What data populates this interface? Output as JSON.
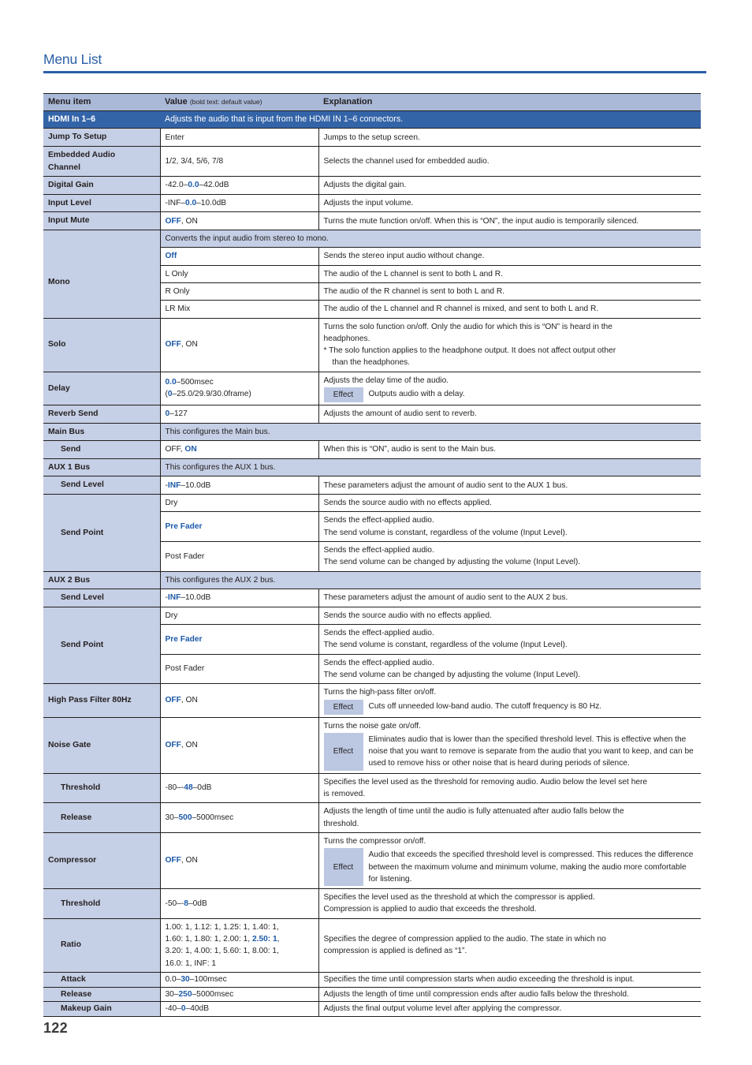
{
  "heading": {
    "title": "Menu List"
  },
  "page_number": "122",
  "colors": {
    "accent_blue": "#2a5fa6",
    "banner_blue": "#3464a8",
    "header_lavender": "#aab9d8",
    "group_lavender": "#c5cfe5",
    "default_value_blue": "#1c5aa8",
    "effect_badge_bg": "#bcc8e2"
  },
  "table": {
    "columns": {
      "menu_item": "Menu item",
      "value": "Value",
      "value_note": "(bold text: default value)",
      "explanation": "Explanation"
    },
    "section_banner": {
      "item": "HDMI In 1–6",
      "text": "Adjusts the audio that is input from the HDMI IN 1–6 connectors."
    },
    "rows": {
      "jump_to_setup": {
        "item": "Jump To Setup",
        "value": "Enter",
        "explanation": "Jumps to the setup screen."
      },
      "embedded_audio_channel": {
        "item_line1": "Embedded Audio",
        "item_line2": "Channel",
        "value": "1/2, 3/4, 5/6, 7/8",
        "explanation": "Selects the channel used for embedded audio."
      },
      "digital_gain": {
        "item": "Digital Gain",
        "value_pre": "-42.0–",
        "value_default": "0.0",
        "value_post": "–42.0dB",
        "explanation": "Adjusts the digital gain."
      },
      "input_level": {
        "item": "Input Level",
        "value_pre": "-INF–",
        "value_default": "0.0",
        "value_post": "–10.0dB",
        "explanation": "Adjusts the input volume."
      },
      "input_mute": {
        "item": "Input Mute",
        "value_default": "OFF",
        "value_post": ", ON",
        "explanation": "Turns the mute function on/off. When this is “ON”, the input audio is temporarily silenced."
      },
      "mono": {
        "item": "Mono",
        "group_text": "Converts the input audio from stereo to mono.",
        "options": [
          {
            "value": "Off",
            "is_default": true,
            "explanation": "Sends the stereo input audio without change."
          },
          {
            "value": "L Only",
            "is_default": false,
            "explanation": "The audio of the L channel is sent to both L and R."
          },
          {
            "value": "R Only",
            "is_default": false,
            "explanation": "The audio of the R channel is sent to both L and R."
          },
          {
            "value": "LR Mix",
            "is_default": false,
            "explanation": "The audio of the L channel and R channel is mixed, and sent to both L and R."
          }
        ]
      },
      "solo": {
        "item": "Solo",
        "value_default": "OFF",
        "value_post": ", ON",
        "exp_line1": "Turns the solo function on/off. Only the audio for which this is “ON” is heard in the",
        "exp_line2": "headphones.",
        "exp_line3": "* The solo function applies to the headphone output. It does not affect output other",
        "exp_line4": "than the headphones."
      },
      "delay": {
        "item": "Delay",
        "value_l1_default": "0.0",
        "value_l1_post": "–500msec",
        "value_l2_pre": "(",
        "value_l2_default": "0",
        "value_l2_post": "–25.0/29.9/30.0frame)",
        "exp_line1": "Adjusts the delay time of the audio.",
        "effect_badge": "Effect",
        "effect_text": "Outputs audio with a delay."
      },
      "reverb_send": {
        "item": "Reverb Send",
        "value_default": "0",
        "value_post": "–127",
        "explanation": "Adjusts the amount of audio sent to reverb."
      },
      "main_bus": {
        "item": "Main Bus",
        "group_text": "This configures the Main bus."
      },
      "main_bus_send": {
        "item": "Send",
        "value_pre": "OFF, ",
        "value_default": "ON",
        "explanation": "When this is “ON”, audio is sent to the Main bus."
      },
      "aux1_bus": {
        "item": "AUX 1 Bus",
        "group_text": "This configures the AUX 1 bus."
      },
      "aux1_send_level": {
        "item": "Send Level",
        "value_pre": "-",
        "value_default": "INF",
        "value_post": "–10.0dB",
        "explanation": "These parameters adjust the amount of audio sent to the AUX 1 bus."
      },
      "aux1_send_point": {
        "item": "Send Point",
        "options": [
          {
            "value": "Dry",
            "is_default": false,
            "exp_line1": "Sends the source audio with no effects applied.",
            "exp_line2": ""
          },
          {
            "value": "Pre Fader",
            "is_default": true,
            "exp_line1": "Sends the effect-applied audio.",
            "exp_line2": "The send volume is constant, regardless of the volume (Input Level)."
          },
          {
            "value": "Post Fader",
            "is_default": false,
            "exp_line1": "Sends the effect-applied audio.",
            "exp_line2": "The send volume can be changed by adjusting the volume (Input Level)."
          }
        ]
      },
      "aux2_bus": {
        "item": "AUX 2 Bus",
        "group_text": "This configures the AUX 2 bus."
      },
      "aux2_send_level": {
        "item": "Send Level",
        "value_pre": "-",
        "value_default": "INF",
        "value_post": "–10.0dB",
        "explanation": "These parameters adjust the amount of audio sent to the AUX 2 bus."
      },
      "aux2_send_point": {
        "item": "Send Point",
        "options": [
          {
            "value": "Dry",
            "is_default": false,
            "exp_line1": "Sends the source audio with no effects applied.",
            "exp_line2": ""
          },
          {
            "value": "Pre Fader",
            "is_default": true,
            "exp_line1": "Sends the effect-applied audio.",
            "exp_line2": "The send volume is constant, regardless of the volume (Input Level)."
          },
          {
            "value": "Post Fader",
            "is_default": false,
            "exp_line1": "Sends the effect-applied audio.",
            "exp_line2": "The send volume can be changed by adjusting the volume (Input Level)."
          }
        ]
      },
      "high_pass_filter": {
        "item": "High Pass Filter 80Hz",
        "value_default": "OFF",
        "value_post": ", ON",
        "exp_line1": "Turns the high-pass filter on/off.",
        "effect_badge": "Effect",
        "effect_text": "Cuts off unneeded low-band audio. The cutoff frequency is 80 Hz."
      },
      "noise_gate": {
        "item": "Noise Gate",
        "value_default": "OFF",
        "value_post": ", ON",
        "exp_line1": "Turns the noise gate on/off.",
        "effect_badge": "Effect",
        "effect_text": "Eliminates audio that is lower than the specified threshold level. This is effective when the noise that you want to remove is separate from the audio that you want to keep, and can be used to remove hiss or other noise that is heard during periods of silence."
      },
      "noise_gate_threshold": {
        "item": "Threshold",
        "value_pre": "-80–-",
        "value_default": "48",
        "value_post": "–0dB",
        "exp_line1": "Specifies the level used as the threshold for removing audio. Audio below the level set here",
        "exp_line2": "is removed."
      },
      "noise_gate_release": {
        "item": "Release",
        "value_pre": "30–",
        "value_default": "500",
        "value_post": "–5000msec",
        "exp_line1": "Adjusts the length of time until the audio is fully attenuated after audio falls below the",
        "exp_line2": "threshold."
      },
      "compressor": {
        "item": "Compressor",
        "value_default": "OFF",
        "value_post": ", ON",
        "exp_line1": "Turns the compressor on/off.",
        "effect_badge": "Effect",
        "effect_text": "Audio that exceeds the specified threshold level is compressed. This reduces the difference between the maximum volume and minimum volume, making the audio more comfortable for listening."
      },
      "compressor_threshold": {
        "item": "Threshold",
        "value_pre": "-50–-",
        "value_default": "8",
        "value_post": "–0dB",
        "exp_line1": "Specifies the level used as the threshold at which the compressor is applied.",
        "exp_line2": "Compression is applied to audio that exceeds the threshold."
      },
      "compressor_ratio": {
        "item": "Ratio",
        "value_line1": "1.00: 1, 1.12: 1, 1.25: 1, 1.40: 1,",
        "value_line2_pre": "1.60: 1, 1.80: 1, 2.00: 1, ",
        "value_line2_default": "2.50: 1",
        "value_line2_post": ",",
        "value_line3": "3.20: 1, 4.00: 1, 5.60: 1, 8.00: 1,",
        "value_line4": "16.0: 1, INF: 1",
        "exp_line1": "Specifies the degree of compression applied to the audio. The state in which no",
        "exp_line2": "compression is applied is defined as “1”."
      },
      "compressor_attack": {
        "item": "Attack",
        "value_pre": "0.0–",
        "value_default": "30",
        "value_post": "–100msec",
        "explanation": "Specifies the time until compression starts when audio exceeding the threshold is input."
      },
      "compressor_release": {
        "item": "Release",
        "value_pre": "30–",
        "value_default": "250",
        "value_post": "–5000msec",
        "explanation": "Adjusts the length of time until compression ends after audio falls below the threshold."
      },
      "makeup_gain": {
        "item": "Makeup Gain",
        "value_pre": "-40–",
        "value_default": "0",
        "value_post": "–40dB",
        "explanation": "Adjusts the final output volume level after applying the compressor."
      }
    }
  }
}
